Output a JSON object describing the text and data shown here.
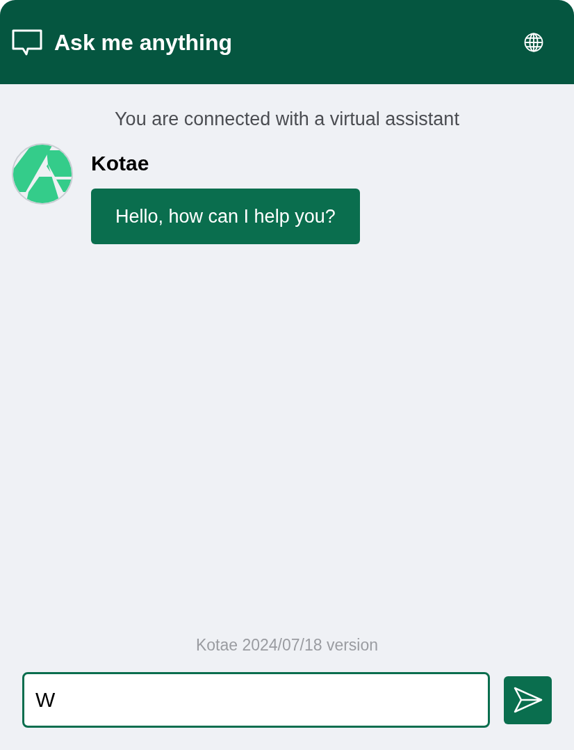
{
  "header": {
    "title": "Ask me anything"
  },
  "system_note": "You are connected with a virtual assistant",
  "messages": [
    {
      "sender": "Kotae",
      "text": "Hello, how can I help you?"
    }
  ],
  "version_note": "Kotae 2024/07/18 version",
  "input": {
    "value": "W"
  }
}
